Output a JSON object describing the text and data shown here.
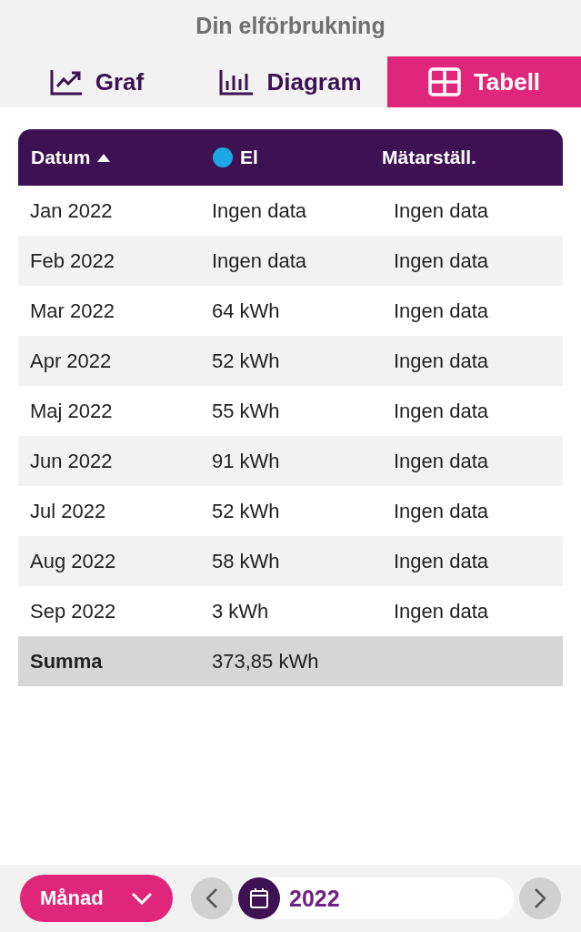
{
  "title": "Din elförbrukning",
  "tabs": [
    {
      "label": "Graf",
      "kind": "line",
      "selected": false
    },
    {
      "label": "Diagram",
      "kind": "bars",
      "selected": false
    },
    {
      "label": "Tabell",
      "kind": "table",
      "selected": true
    }
  ],
  "table": {
    "columns": [
      {
        "label": "Datum",
        "kind": "sort"
      },
      {
        "label": "El",
        "kind": "dot",
        "color": "#1ba7e1"
      },
      {
        "label": "Mätarställ.",
        "kind": "plain"
      }
    ],
    "rows": [
      [
        "Jan 2022",
        "Ingen data",
        "Ingen data"
      ],
      [
        "Feb 2022",
        "Ingen data",
        "Ingen data"
      ],
      [
        "Mar 2022",
        "64 kWh",
        "Ingen data"
      ],
      [
        "Apr 2022",
        "52 kWh",
        "Ingen data"
      ],
      [
        "Maj 2022",
        "55 kWh",
        "Ingen data"
      ],
      [
        "Jun 2022",
        "91 kWh",
        "Ingen data"
      ],
      [
        "Jul 2022",
        "52 kWh",
        "Ingen data"
      ],
      [
        "Aug 2022",
        "58 kWh",
        "Ingen data"
      ],
      [
        "Sep 2022",
        "3 kWh",
        "Ingen data"
      ]
    ],
    "total": [
      "Summa",
      "373,85 kWh"
    ]
  },
  "footer": {
    "period": "Månad",
    "year": "2022"
  }
}
